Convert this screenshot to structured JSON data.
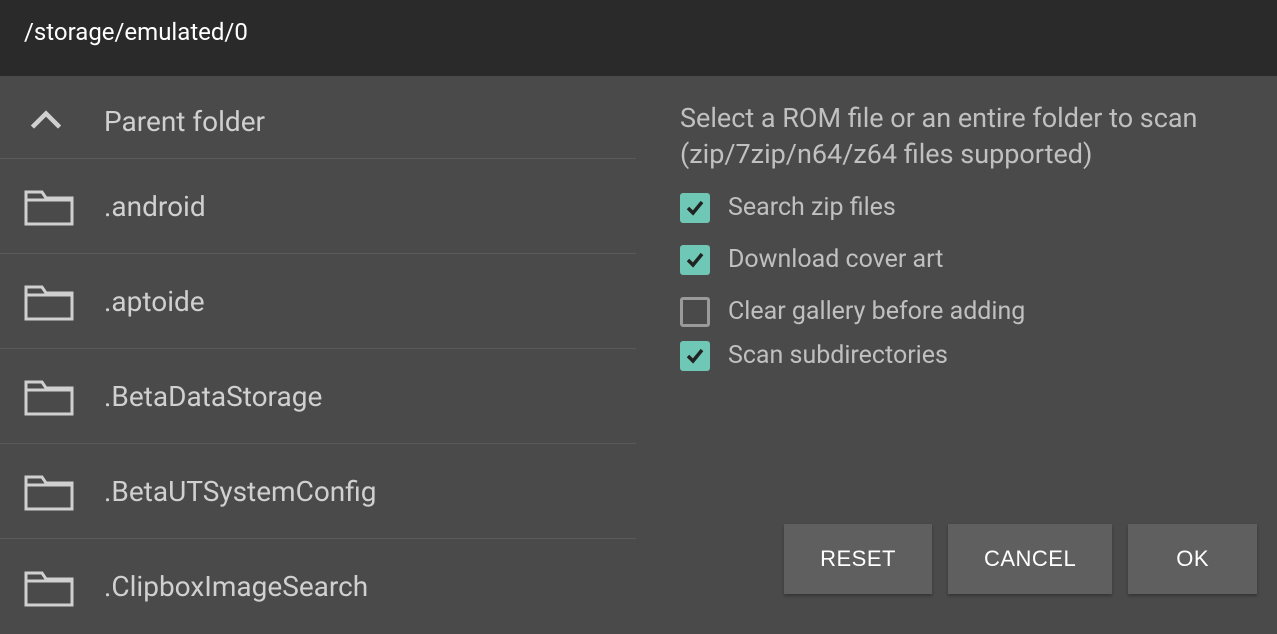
{
  "header": {
    "path": "/storage/emulated/0"
  },
  "list": {
    "parent_label": "Parent folder",
    "items": [
      {
        "label": ".android"
      },
      {
        "label": ".aptoide"
      },
      {
        "label": ".BetaDataStorage"
      },
      {
        "label": ".BetaUTSystemConfig"
      },
      {
        "label": ".ClipboxImageSearch"
      }
    ]
  },
  "right": {
    "instruction": "Select a ROM file or an entire folder to scan (zip/7zip/n64/z64 files supported)",
    "options": {
      "search_zip": {
        "label": "Search zip files",
        "checked": true
      },
      "download_cover": {
        "label": "Download cover art",
        "checked": true
      },
      "clear_gallery": {
        "label": "Clear gallery before adding",
        "checked": false
      },
      "scan_subdirs": {
        "label": "Scan subdirectories",
        "checked": true
      }
    },
    "buttons": {
      "reset": "RESET",
      "cancel": "CANCEL",
      "ok": "OK"
    }
  },
  "colors": {
    "accent": "#6fc7b5"
  }
}
